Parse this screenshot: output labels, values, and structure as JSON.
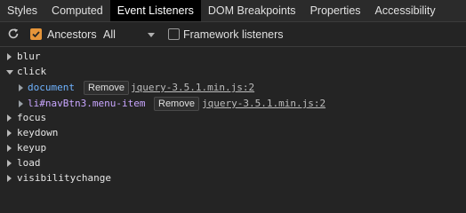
{
  "tabs": [
    "Styles",
    "Computed",
    "Event Listeners",
    "DOM Breakpoints",
    "Properties",
    "Accessibility"
  ],
  "toolbar": {
    "ancestors_label": "Ancestors",
    "ancestors_checked": true,
    "filter_value": "All",
    "framework_label": "Framework listeners",
    "framework_checked": false
  },
  "events": {
    "blur": "blur",
    "click": "click",
    "focus": "focus",
    "keydown": "keydown",
    "keyup": "keyup",
    "load": "load",
    "visibilitychange": "visibilitychange"
  },
  "click_listeners": [
    {
      "node": "document",
      "remove_label": "Remove",
      "source": "jquery-3.5.1.min.js:2"
    },
    {
      "node": "li#navBtn3.menu-item",
      "remove_label": "Remove",
      "source": "jquery-3.5.1.min.js:2"
    }
  ],
  "colors": {
    "accent": "#e6953a",
    "node_document": "#6fb3ff",
    "node_element": "#c9a6ff",
    "active_tab_bg": "#000000"
  }
}
